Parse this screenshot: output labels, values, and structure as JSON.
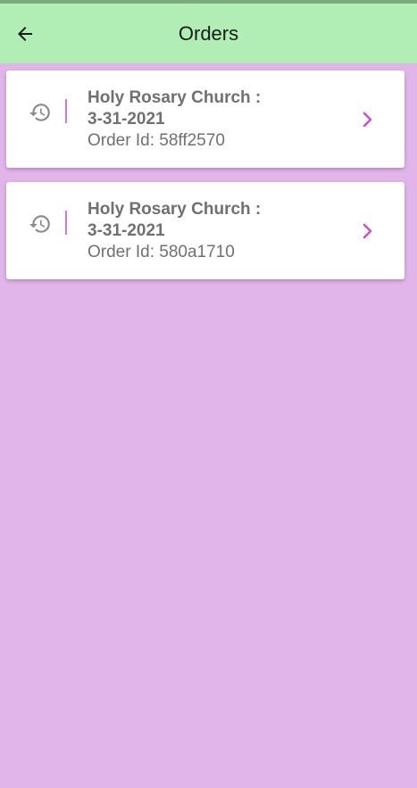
{
  "app_bar": {
    "title": "Orders",
    "back_icon": "arrow-left-icon",
    "background": "#b0eeb5"
  },
  "page": {
    "background": "#e1b4ea"
  },
  "orders": [
    {
      "title_line1": "Holy Rosary Church :",
      "title_line2": "3-31-2021",
      "order_id_label": "Order Id:",
      "order_id": "58ff2570",
      "leading_icon": "history-icon",
      "trailing_icon": "chevron-right-icon"
    },
    {
      "title_line1": "Holy Rosary Church :",
      "title_line2": "3-31-2021",
      "order_id_label": "Order Id:",
      "order_id": "580a1710",
      "leading_icon": "history-icon",
      "trailing_icon": "chevron-right-icon"
    }
  ],
  "colors": {
    "accent": "#c054c9",
    "divider": "#d07ad6",
    "text_secondary": "#707070"
  }
}
